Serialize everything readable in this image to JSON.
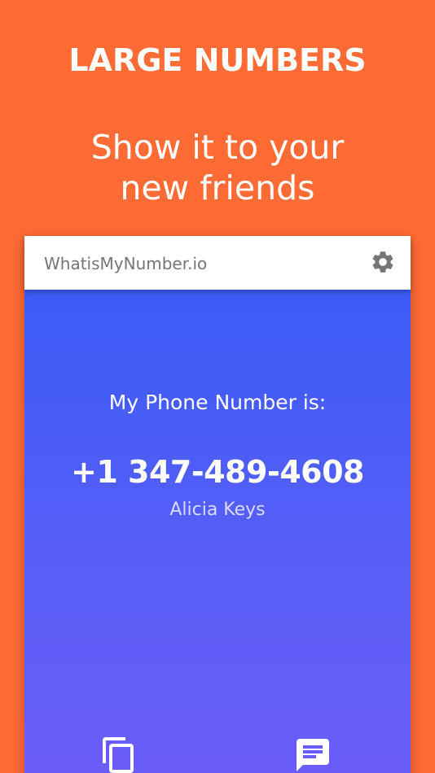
{
  "promo": {
    "headline": "LARGE NUMBERS",
    "subline_1": "Show it to your",
    "subline_2": "new friends"
  },
  "appbar": {
    "title": "WhatisMyNumber.io",
    "settings_icon": "gear-icon"
  },
  "main": {
    "label": "My Phone Number is:",
    "phone_number": "+1 347-489-4608",
    "owner_name": "Alicia Keys"
  },
  "actions": {
    "copy_icon": "copy-icon",
    "message_icon": "message-icon"
  },
  "colors": {
    "background": "#FF6B35",
    "gradient_top": "#3B5BF6",
    "gradient_bottom": "#6C5CF8",
    "appbar": "#FFFFFF",
    "title_text": "#757575"
  }
}
